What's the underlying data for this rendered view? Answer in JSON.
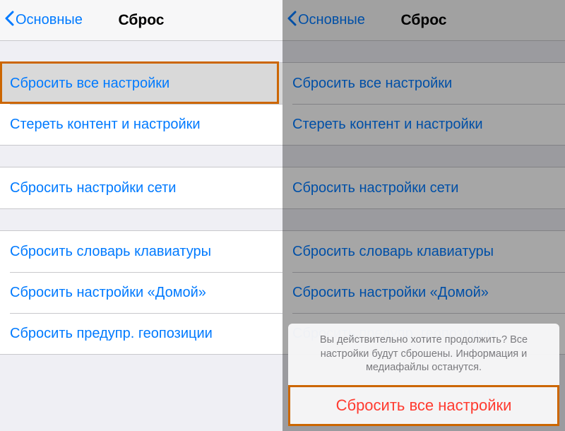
{
  "nav": {
    "back_label": "Основные",
    "title": "Сброс"
  },
  "group1": {
    "a": "Сбросить все настройки",
    "b": "Стереть контент и настройки"
  },
  "group2": {
    "a": "Сбросить настройки сети"
  },
  "group3": {
    "a": "Сбросить словарь клавиатуры",
    "b": "Сбросить настройки «Домой»",
    "c": "Сбросить предупр. геопозиции"
  },
  "actionsheet": {
    "message": "Вы действительно хотите продолжить? Все настройки будут сброшены. Информация и медиафайлы останутся.",
    "destructive": "Сбросить все настройки"
  }
}
